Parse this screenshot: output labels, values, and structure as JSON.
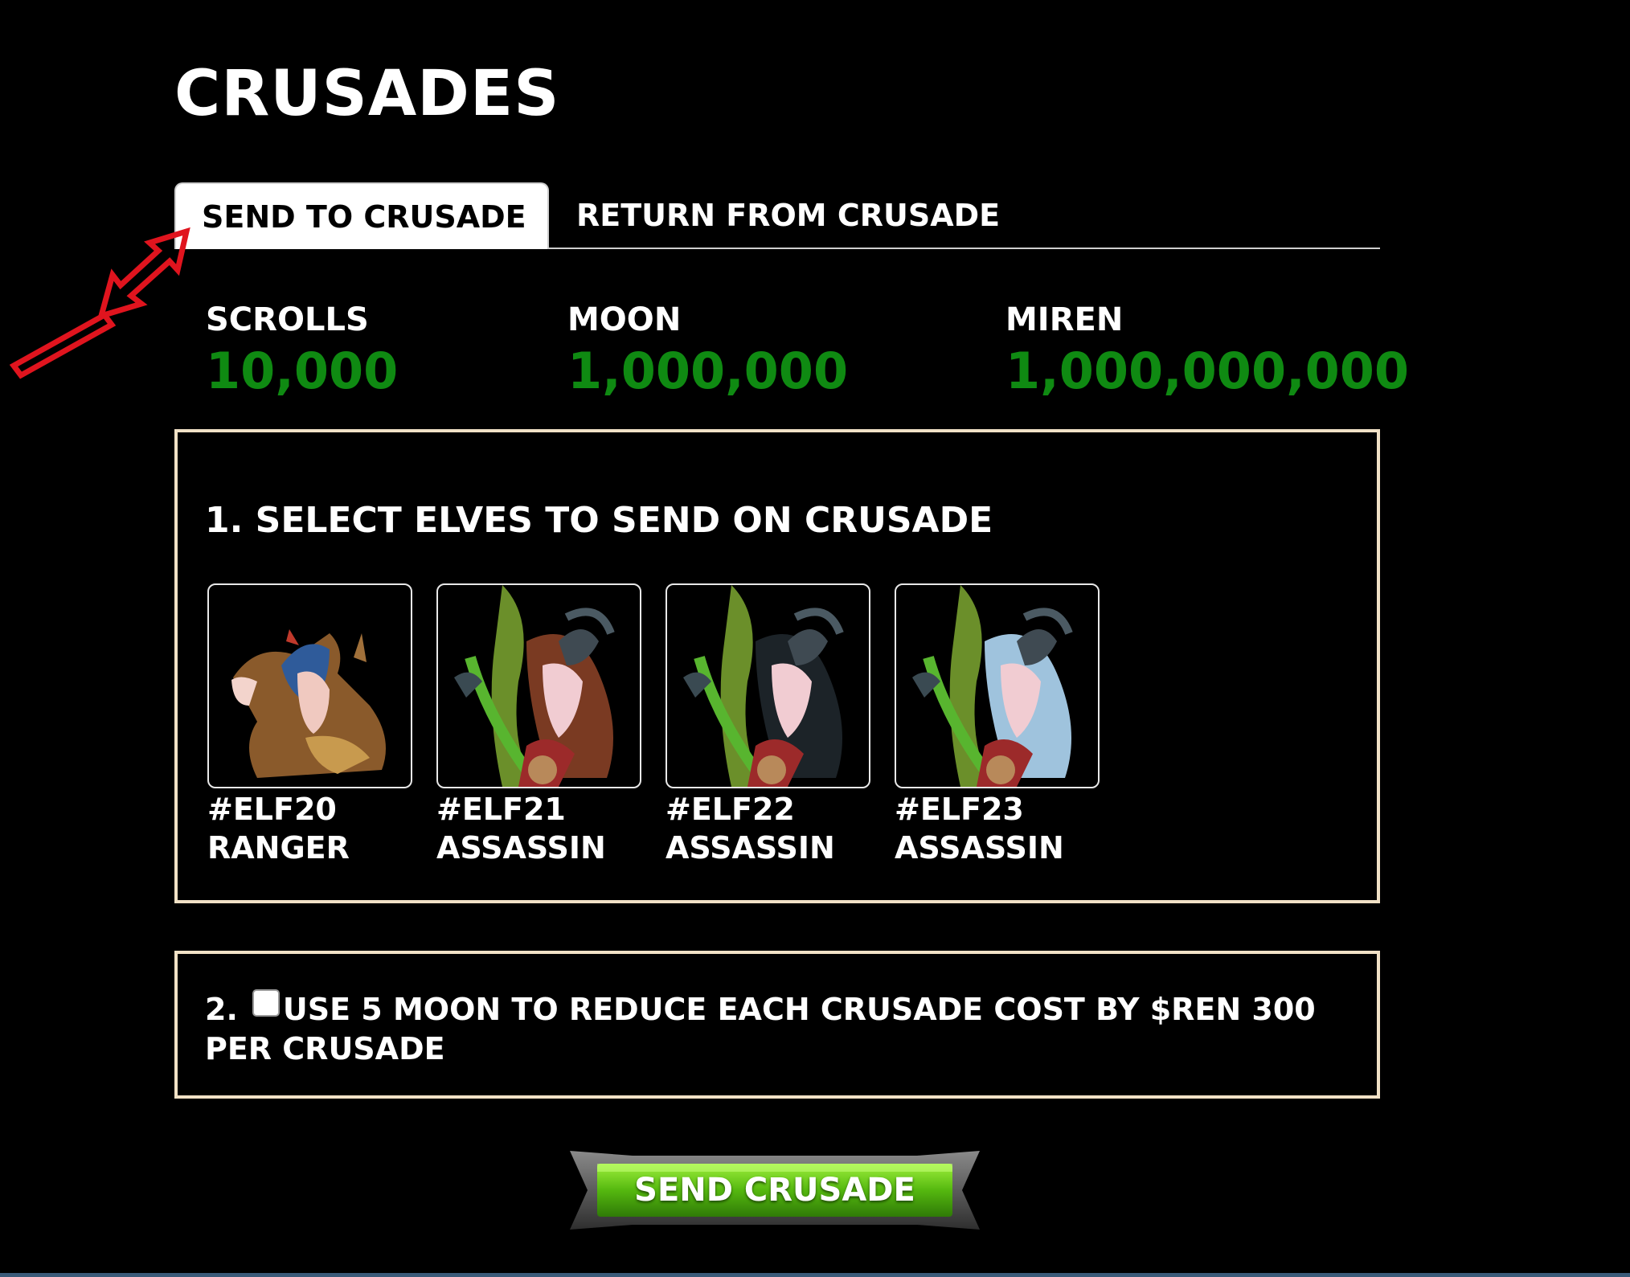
{
  "page": {
    "title": "CRUSADES"
  },
  "tabs": [
    {
      "label": "SEND TO CRUSADE",
      "active": true
    },
    {
      "label": "RETURN FROM CRUSADE",
      "active": false
    }
  ],
  "stats": [
    {
      "label": "SCROLLS",
      "value": "10,000"
    },
    {
      "label": "MOON",
      "value": "1,000,000"
    },
    {
      "label": "MIREN",
      "value": "1,000,000,000"
    }
  ],
  "select_section": {
    "title": "1. SELECT ELVES TO SEND ON CRUSADE",
    "elves": [
      {
        "id": "#ELF20",
        "class": "RANGER"
      },
      {
        "id": "#ELF21",
        "class": "ASSASSIN"
      },
      {
        "id": "#ELF22",
        "class": "ASSASSIN"
      },
      {
        "id": "#ELF23",
        "class": "ASSASSIN"
      }
    ]
  },
  "moon_section": {
    "number": "2.",
    "text": "USE 5 MOON TO REDUCE EACH CRUSADE COST BY $REN 300 PER CRUSADE",
    "checked": false
  },
  "send_button": {
    "label": "SEND CRUSADE"
  },
  "colors": {
    "accent_green": "#0f8a12",
    "panel_border": "#f1e1c6",
    "annotation_red": "#e0141e"
  }
}
